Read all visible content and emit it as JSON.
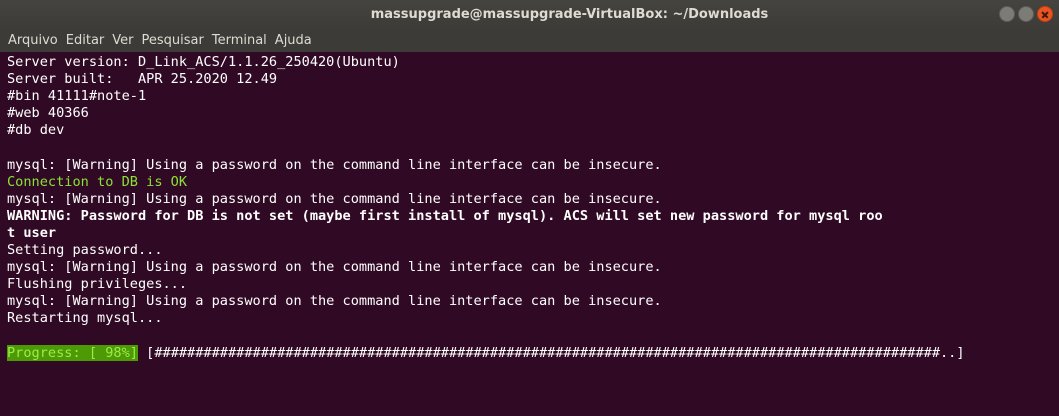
{
  "window": {
    "title": "massupgrade@massupgrade-VirtualBox: ~/Downloads"
  },
  "menu": {
    "items": [
      "Arquivo",
      "Editar",
      "Ver",
      "Pesquisar",
      "Terminal",
      "Ajuda"
    ]
  },
  "terminal": {
    "lines": [
      {
        "text": "Server version: D_Link_ACS/1.1.26_250420(Ubuntu)",
        "style": "normal"
      },
      {
        "text": "Server built:   APR 25.2020 12.49",
        "style": "normal"
      },
      {
        "text": "#bin 41111#note-1",
        "style": "normal"
      },
      {
        "text": "#web 40366",
        "style": "normal"
      },
      {
        "text": "#db dev",
        "style": "normal"
      },
      {
        "text": "",
        "style": "normal"
      },
      {
        "text": "mysql: [Warning] Using a password on the command line interface can be insecure.",
        "style": "normal"
      },
      {
        "text": "Connection to DB is OK",
        "style": "green"
      },
      {
        "text": "mysql: [Warning] Using a password on the command line interface can be insecure.",
        "style": "normal"
      },
      {
        "text": "WARNING: Password for DB is not set (maybe first install of mysql). ACS will set new password for mysql roo",
        "style": "bold"
      },
      {
        "text": "t user",
        "style": "bold"
      },
      {
        "text": "Setting password...",
        "style": "normal"
      },
      {
        "text": "mysql: [Warning] Using a password on the command line interface can be insecure.",
        "style": "normal"
      },
      {
        "text": "Flushing privileges...",
        "style": "normal"
      },
      {
        "text": "mysql: [Warning] Using a password on the command line interface can be insecure.",
        "style": "normal"
      },
      {
        "text": "Restarting mysql...",
        "style": "normal"
      },
      {
        "text": "",
        "style": "normal"
      }
    ],
    "progress": {
      "label": "Progress: [ 98%]",
      "bar": " [################################################################################################..] "
    }
  },
  "colors": {
    "background": "#300a24",
    "titlebar": "#3c3b37",
    "close_button": "#e95420",
    "ok_text": "#8ae234",
    "progress_bg": "#4e9a06"
  }
}
